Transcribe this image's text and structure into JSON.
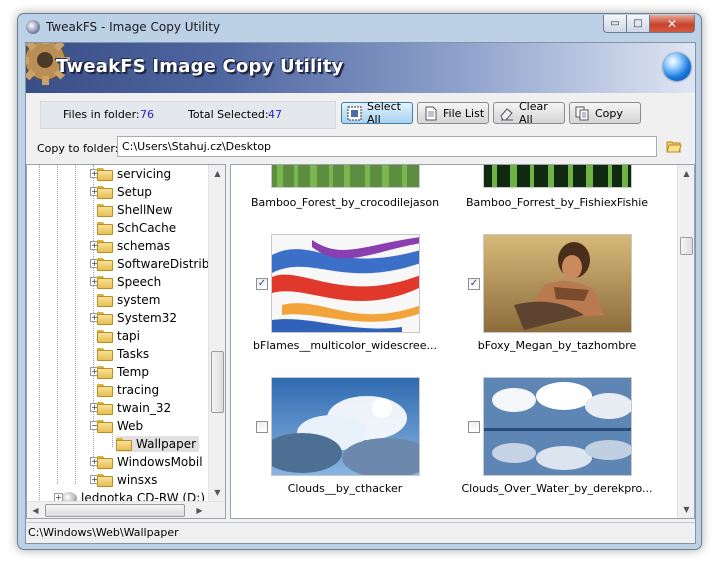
{
  "window": {
    "title": "TweakFS - Image Copy Utility",
    "minimize_glyph": "▭",
    "maximize_glyph": "□",
    "close_glyph": "✕"
  },
  "banner": {
    "title": "TweakFS Image Copy Utility",
    "logo_icon": "gear-icon",
    "help_icon": "globe-icon"
  },
  "info": {
    "files_label": "Files in folder:",
    "files_value": "76",
    "selected_label": "Total Selected:",
    "selected_value": "47"
  },
  "toolbar": {
    "select_all": "Select All",
    "file_list": "File List",
    "clear_all": "Clear All",
    "copy": "Copy"
  },
  "copy_to": {
    "label": "Copy to folder:",
    "value": "C:\\Users\\Stahuj.cz\\Desktop"
  },
  "tree": {
    "items": [
      {
        "label": "servicing",
        "expandable": true
      },
      {
        "label": "Setup",
        "expandable": true
      },
      {
        "label": "ShellNew",
        "expandable": false
      },
      {
        "label": "SchCache",
        "expandable": false
      },
      {
        "label": "schemas",
        "expandable": true
      },
      {
        "label": "SoftwareDistrib",
        "expandable": true
      },
      {
        "label": "Speech",
        "expandable": true
      },
      {
        "label": "system",
        "expandable": false
      },
      {
        "label": "System32",
        "expandable": true
      },
      {
        "label": "tapi",
        "expandable": false
      },
      {
        "label": "Tasks",
        "expandable": false
      },
      {
        "label": "Temp",
        "expandable": true
      },
      {
        "label": "tracing",
        "expandable": false
      },
      {
        "label": "twain_32",
        "expandable": true
      },
      {
        "label": "Web",
        "expandable": true,
        "expanded": true
      },
      {
        "label": "Wallpaper",
        "expandable": false,
        "selected": true
      },
      {
        "label": "WindowsMobil",
        "expandable": true
      },
      {
        "label": "winsxs",
        "expandable": true
      },
      {
        "label": "lednotka CD-RW (D:)",
        "expandable": true
      }
    ]
  },
  "images": [
    {
      "caption": "Bamboo_Forest_by_crocodilejason",
      "checked": false
    },
    {
      "caption": "Bamboo_Forrest_by_FishiexFishie",
      "checked": false
    },
    {
      "caption": "bFlames__multicolor_widescree...",
      "checked": true
    },
    {
      "caption": "bFoxy_Megan_by_tazhombre",
      "checked": true
    },
    {
      "caption": "Clouds__by_cthacker",
      "checked": false
    },
    {
      "caption": "Clouds_Over_Water_by_derekpro...",
      "checked": false
    }
  ],
  "check_glyph": "✓",
  "status": {
    "path": "C:\\Windows\\Web\\Wallpaper"
  },
  "colors": {
    "accent": "#2323c4",
    "banner": "#3a4e86"
  }
}
